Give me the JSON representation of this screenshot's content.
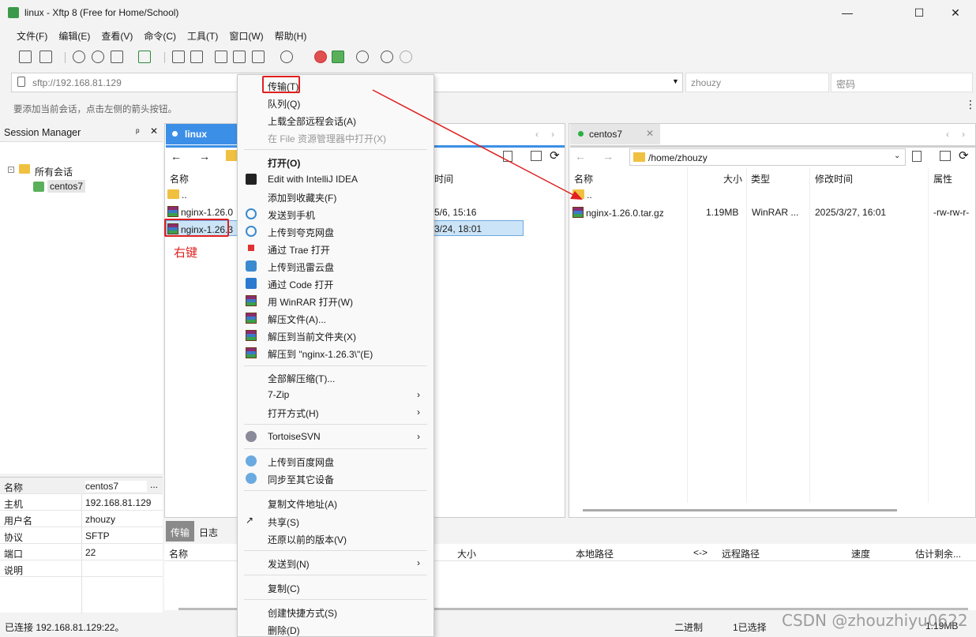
{
  "window": {
    "title": "linux - Xftp 8 (Free for Home/School)",
    "minimize": "—",
    "maximize": "☐",
    "close": "✕"
  },
  "menu": [
    "文件(F)",
    "编辑(E)",
    "查看(V)",
    "命令(C)",
    "工具(T)",
    "窗口(W)",
    "帮助(H)"
  ],
  "address": {
    "url": "sftp://192.168.81.129",
    "username": "zhouzy",
    "password_placeholder": "密码"
  },
  "hint": "要添加当前会话，点击左侧的箭头按钮。",
  "session_manager": {
    "title": "Session Manager",
    "tree": [
      "所有会话",
      "centos7"
    ]
  },
  "properties": [
    {
      "key": "名称",
      "value": "centos7"
    },
    {
      "key": "主机",
      "value": "192.168.81.129"
    },
    {
      "key": "用户名",
      "value": "zhouzy"
    },
    {
      "key": "协议",
      "value": "SFTP"
    },
    {
      "key": "端口",
      "value": "22"
    },
    {
      "key": "说明",
      "value": ""
    }
  ],
  "left_pane": {
    "tab": "linux",
    "col_name": "名称",
    "col_time": "时间",
    "rows": [
      {
        "name": "..",
        "time": ""
      },
      {
        "name": "nginx-1.26.0",
        "time": "5/6, 15:16"
      },
      {
        "name": "nginx-1.26.3",
        "time": "3/24, 18:01"
      }
    ],
    "annotation": "右键"
  },
  "right_pane": {
    "tab": "centos7",
    "path": "/home/zhouzy",
    "cols": [
      "名称",
      "大小",
      "类型",
      "修改时间",
      "属性"
    ],
    "rows": [
      {
        "name": "..",
        "size": "",
        "type": "",
        "modified": "",
        "attr": ""
      },
      {
        "name": "nginx-1.26.0.tar.gz",
        "size": "1.19MB",
        "type": "WinRAR ...",
        "modified": "2025/3/27, 16:01",
        "attr": "-rw-rw-r-"
      }
    ]
  },
  "transfer": {
    "tabs": [
      "传输",
      "日志"
    ],
    "cols": [
      "名称",
      "大小",
      "本地路径",
      "<->",
      "远程路径",
      "速度",
      "估计剩余..."
    ]
  },
  "status": {
    "left": "已连接 192.168.81.129:22。",
    "mode": "二进制",
    "selected": "1已选择",
    "size": "1.19MB"
  },
  "context_menu": {
    "items": [
      {
        "label": "传输(T)",
        "bold": false,
        "disabled": false
      },
      {
        "label": "队列(Q)"
      },
      {
        "label": "上载全部远程会话(A)"
      },
      {
        "label": "在 File 资源管理器中打开(X)",
        "disabled": true
      },
      {
        "label": "打开(O)",
        "bold": true
      },
      {
        "label": "Edit with IntelliJ IDEA"
      },
      {
        "label": "添加到收藏夹(F)"
      },
      {
        "label": "发送到手机"
      },
      {
        "label": "上传到夸克网盘"
      },
      {
        "label": "通过 Trae 打开"
      },
      {
        "label": "上传到迅雷云盘"
      },
      {
        "label": "通过 Code 打开"
      },
      {
        "label": "用 WinRAR 打开(W)"
      },
      {
        "label": "解压文件(A)..."
      },
      {
        "label": "解压到当前文件夹(X)"
      },
      {
        "label": "解压到 \"nginx-1.26.3\\\"(E)"
      },
      {
        "label": "全部解压缩(T)..."
      },
      {
        "label": "7-Zip"
      },
      {
        "label": "打开方式(H)"
      },
      {
        "label": "TortoiseSVN"
      },
      {
        "label": "上传到百度网盘"
      },
      {
        "label": "同步至其它设备"
      },
      {
        "label": "复制文件地址(A)"
      },
      {
        "label": "共享(S)"
      },
      {
        "label": "还原以前的版本(V)"
      },
      {
        "label": "发送到(N)"
      },
      {
        "label": "复制(C)"
      },
      {
        "label": "创建快捷方式(S)"
      },
      {
        "label": "删除(D)"
      }
    ]
  },
  "watermark": "CSDN @zhouzhiyu0622",
  "colors": {
    "accent": "#3c8fe6",
    "highlight": "#e02020",
    "selected_row": "#cce4f7"
  }
}
